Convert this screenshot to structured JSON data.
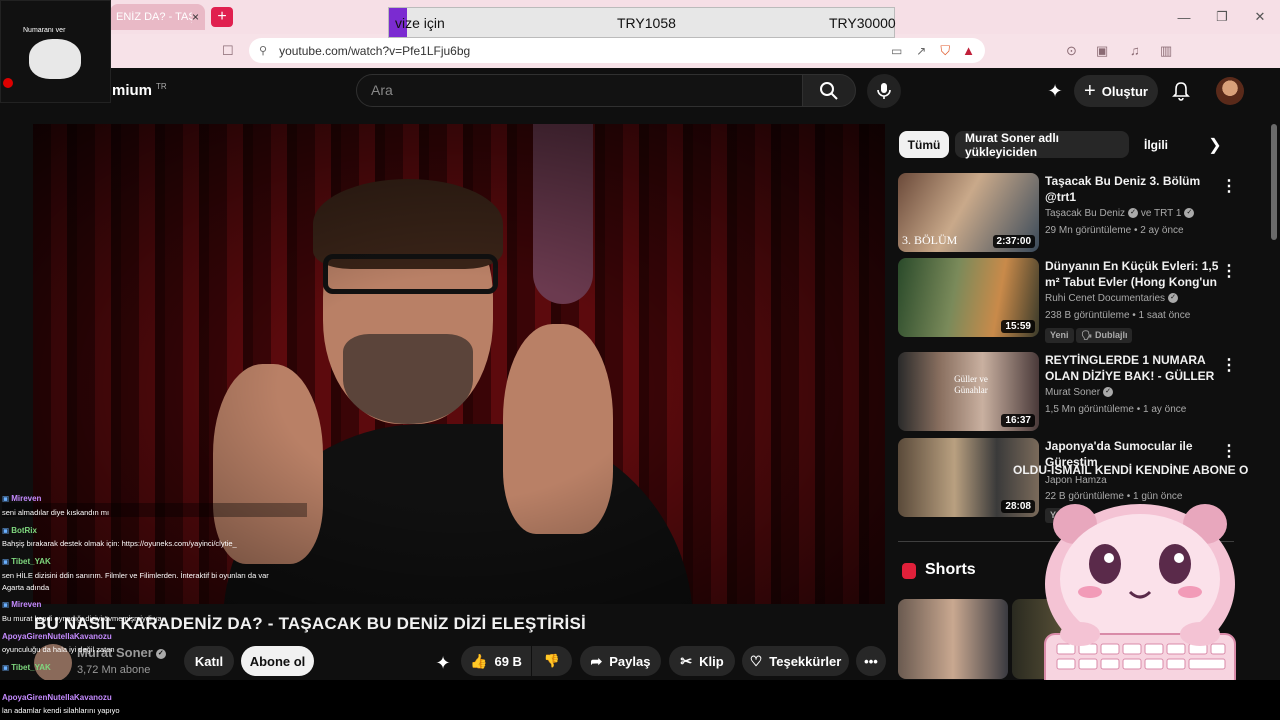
{
  "browser": {
    "tab_title": "ENİZ DA? - TAŞ",
    "tab_close": "×",
    "new_tab": "+",
    "url": "youtube.com/watch?v=Pfe1LFju6bg"
  },
  "price_bar": {
    "label": "vize için",
    "price1": "TRY1058",
    "price2": "TRY30000"
  },
  "webcam": {
    "label": "Numaranı ver"
  },
  "header": {
    "logo_text": "mium",
    "logo_country": "TR",
    "search_placeholder": "Ara",
    "create_label": "Oluştur"
  },
  "video": {
    "title": "BU NASIL KARADENİZ DA? - TAŞACAK BU DENİZ DİZİ ELEŞTİRİSİ",
    "channel": "Murat Soner",
    "subscribers": "3,72 Mn abone",
    "join_label": "Katıl",
    "subscribe_label": "Abone ol",
    "likes": "69 B",
    "share_label": "Paylaş",
    "clip_label": "Klip",
    "thanks_label": "Teşekkürler",
    "more": "•••"
  },
  "chips": [
    "Tümü",
    "Murat Soner adlı yükleyiciden",
    "İlgili"
  ],
  "recommendations": [
    {
      "title": "Taşacak Bu Deniz 3. Bölüm @trt1",
      "channel": "Taşacak Bu Deniz",
      "channel_extra": "ve TRT 1",
      "meta": "29 Mn görüntüleme • 2 ay önce",
      "duration": "2:37:00",
      "tags": [],
      "thumb_caption": "3. BÖLÜM"
    },
    {
      "title": "Dünyanın En Küçük Evleri: 1,5 m² Tabut Evler (Hong Kong'un ...",
      "channel": "Ruhi Cenet Documentaries",
      "channel_extra": "",
      "meta": "238 B görüntüleme • 1 saat önce",
      "duration": "15:59",
      "tags": [
        "Yeni",
        "Dublajlı"
      ],
      "thumb_caption": ""
    },
    {
      "title": "REYTİNGLERDE 1 NUMARA OLAN DİZİYE BAK! - GÜLLER V...",
      "channel": "Murat Soner",
      "channel_extra": "",
      "meta": "1,5 Mn görüntüleme • 1 ay önce",
      "duration": "16:37",
      "tags": [],
      "thumb_caption": "Güller ve Günahlar"
    },
    {
      "title": "Japonya'da Sumocular ile Güreştim",
      "channel": "Japon Hamza",
      "channel_extra": "",
      "meta": "22 B görüntüleme • 1 gün önce",
      "duration": "28:08",
      "tags": [
        "Yeni"
      ],
      "thumb_caption": ""
    }
  ],
  "shorts_label": "Shorts",
  "ticker": "OLDU-İSMAİL KENDİ KENDİNE ABONE O",
  "chat": [
    {
      "user": "Mireven",
      "message": "seni almadılar diye kıskandın mı",
      "color": "#c58bff"
    },
    {
      "user": "BotRix",
      "message": "Bahşiş bırakarak destek olmak için: https://oyuneks.com/yayinci/clytie_",
      "color": "#7fd87f"
    },
    {
      "user": "Tibet_YAK",
      "message": "sen HİLE dizisini ddin sanırım. Filmler ve Filimlerden. İnteraktif bi oyunları da var",
      "color": "#7fd87f"
    },
    {
      "user": "",
      "message": "Agarta adında",
      "color": "#fff"
    },
    {
      "user": "Mireven",
      "message": "Bu murat kendi oynadığı diziyi övmemişmiydi ya",
      "color": "#c58bff"
    },
    {
      "user": "ApoyaGirenNutellaKavanozu",
      "message": "oyunculuğu da hala iyi değil zaten",
      "color": "#c58bff"
    },
    {
      "user": "Tibet_YAK",
      "message": "",
      "color": "#7fd87f"
    },
    {
      "user": "ApoyaGirenNutellaKavanozu",
      "message": "lan adamlar kendi silahlarını yapıyo",
      "color": "#c58bff"
    }
  ],
  "colors": {
    "yt_bg": "#0f0f0f",
    "chip_bg": "#272727",
    "shorts_red": "#e0203a",
    "price_badge": "#7b2bd1"
  }
}
